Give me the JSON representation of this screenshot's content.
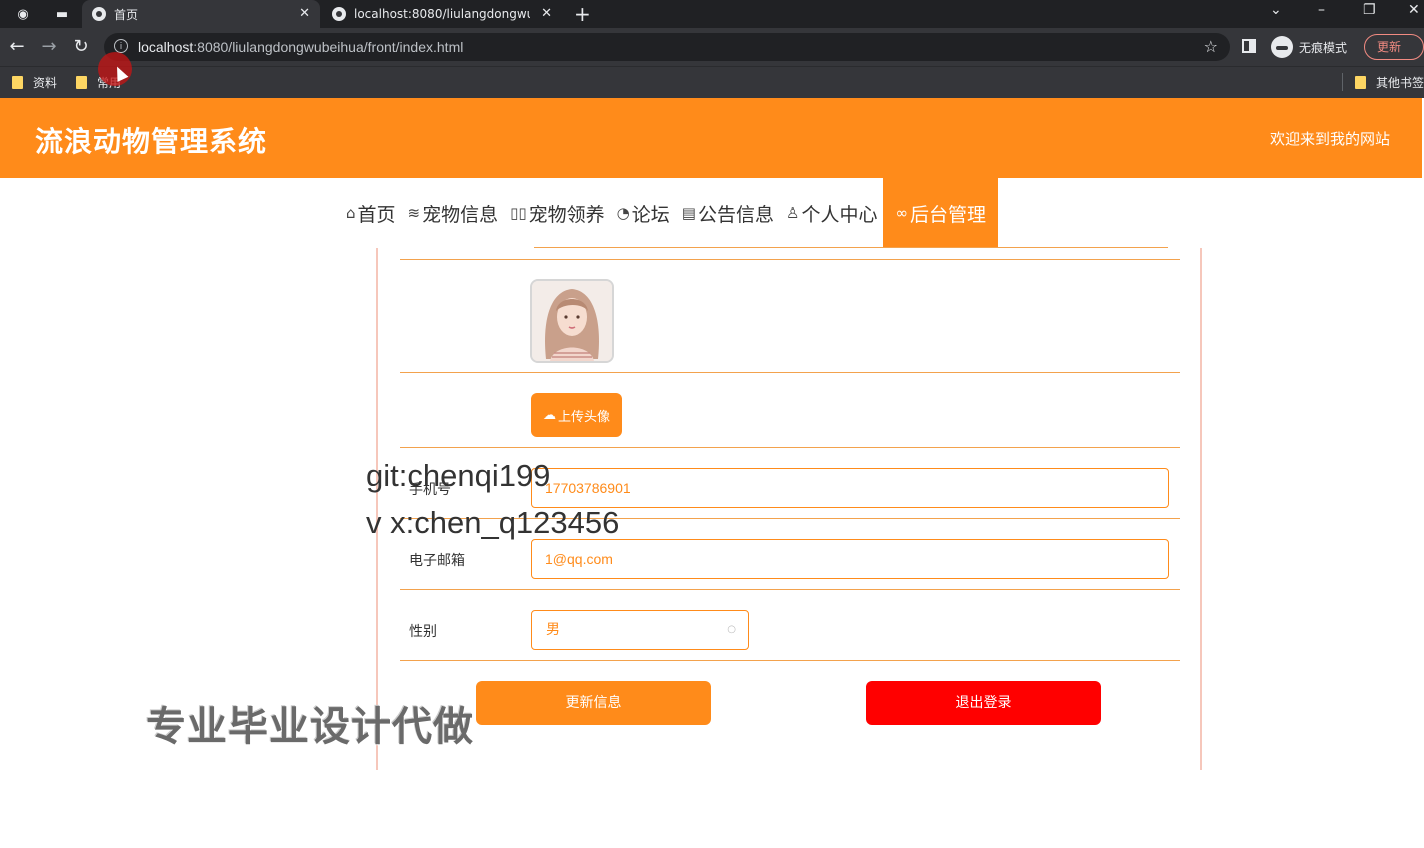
{
  "browser": {
    "tabs": [
      {
        "title": "首页",
        "active": true
      },
      {
        "title": "localhost:8080/liulangdongwu",
        "active": false
      }
    ],
    "new_tab": "+",
    "url_host": "localhost",
    "url_rest": ":8080/liulangdongwubeihua/front/index.html",
    "incognito_label": "无痕模式",
    "update_label": "更新",
    "bookmarks": [
      "资料",
      "常用"
    ],
    "other_bookmarks": "其他书签"
  },
  "header": {
    "title": "流浪动物管理系统",
    "welcome": "欢迎来到我的网站"
  },
  "nav": [
    {
      "icon": "home-icon",
      "glyph": "⌂",
      "label": "首页"
    },
    {
      "icon": "layers-icon",
      "glyph": "≋",
      "label": "宠物信息"
    },
    {
      "icon": "grid-icon",
      "glyph": "▯▯",
      "label": "宠物领养"
    },
    {
      "icon": "forum-icon",
      "glyph": "◔",
      "label": "论坛"
    },
    {
      "icon": "notice-icon",
      "glyph": "▤",
      "label": "公告信息"
    },
    {
      "icon": "user-icon",
      "glyph": "♙",
      "label": "个人中心"
    },
    {
      "icon": "link-icon",
      "glyph": "∞",
      "label": "后台管理",
      "active": true
    }
  ],
  "profile": {
    "upload_label": "上传头像",
    "phone": {
      "label": "手机号",
      "value": "17703786901"
    },
    "email": {
      "label": "电子邮箱",
      "value": "1@qq.com"
    },
    "gender": {
      "label": "性别",
      "value": "男"
    },
    "update_button": "更新信息",
    "logout_button": "退出登录"
  },
  "watermark": {
    "line1": "git:chenqi199",
    "line2": "v x:chen_q123456",
    "big": "专业毕业设计代做"
  },
  "colors": {
    "brand_orange": "#ff8b1a",
    "logout_red": "#ff0000",
    "chrome_dark": "#202124"
  }
}
